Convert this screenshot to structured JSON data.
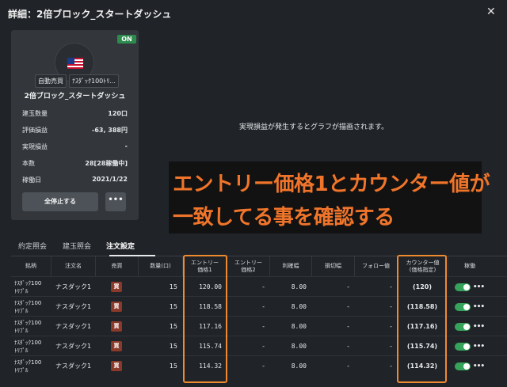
{
  "window": {
    "title": "詳細：2倍ブロック_スタートダッシュ",
    "close": "✕"
  },
  "card": {
    "status": "ON",
    "tags": [
      "自動売買",
      "ﾅｽﾀﾞｯｸ100ﾄﾘ..."
    ],
    "name": "2倍ブロック_スタートダッシュ",
    "stats": [
      {
        "label": "建玉数量",
        "value": "120口"
      },
      {
        "label": "評価損益",
        "value": "-63, 388円"
      },
      {
        "label": "実現損益",
        "value": "-"
      },
      {
        "label": "本数",
        "value": "28[28稼働中]"
      },
      {
        "label": "稼働日",
        "value": "2021/1/22"
      }
    ],
    "stop_all": "全停止する",
    "more": "•••"
  },
  "graph_message": "実現損益が発生するとグラフが描画されます。",
  "annotation": {
    "line1": "エントリー価格1とカウンター値が",
    "line2": "一致してる事を確認する"
  },
  "tabs": [
    {
      "label": "約定照会"
    },
    {
      "label": "建玉照会"
    },
    {
      "label": "注文設定"
    }
  ],
  "table": {
    "headers": {
      "symbol": "銘柄",
      "order_name": "注文名",
      "side": "売買",
      "qty": "数量(口)",
      "entry1_a": "エントリー",
      "entry1_b": "価格1",
      "entry2_a": "エントリー",
      "entry2_b": "価格2",
      "profit": "利確幅",
      "loss": "損切幅",
      "follow": "フォロー値",
      "counter_a": "カウンター値",
      "counter_b": "(価格指定)",
      "active": "稼働"
    },
    "rows": [
      {
        "sym1": "ﾅｽﾀﾞｯｸ100",
        "sym2": "ﾄﾘﾌﾟﾙ",
        "order": "ナスダック1",
        "side": "買",
        "qty": "15",
        "entry1": "120.00",
        "entry2": "-",
        "profit": "8.00",
        "loss": "-",
        "follow": "-",
        "counter": "(120)"
      },
      {
        "sym1": "ﾅｽﾀﾞｯｸ100",
        "sym2": "ﾄﾘﾌﾟﾙ",
        "order": "ナスダック1",
        "side": "買",
        "qty": "15",
        "entry1": "118.58",
        "entry2": "-",
        "profit": "8.00",
        "loss": "-",
        "follow": "-",
        "counter": "(118.58)"
      },
      {
        "sym1": "ﾅｽﾀﾞｯｸ100",
        "sym2": "ﾄﾘﾌﾟﾙ",
        "order": "ナスダック1",
        "side": "買",
        "qty": "15",
        "entry1": "117.16",
        "entry2": "-",
        "profit": "8.00",
        "loss": "-",
        "follow": "-",
        "counter": "(117.16)"
      },
      {
        "sym1": "ﾅｽﾀﾞｯｸ100",
        "sym2": "ﾄﾘﾌﾟﾙ",
        "order": "ナスダック1",
        "side": "買",
        "qty": "15",
        "entry1": "115.74",
        "entry2": "-",
        "profit": "8.00",
        "loss": "-",
        "follow": "-",
        "counter": "(115.74)"
      },
      {
        "sym1": "ﾅｽﾀﾞｯｸ100",
        "sym2": "ﾄﾘﾌﾟﾙ",
        "order": "ナスダック1",
        "side": "買",
        "qty": "15",
        "entry1": "114.32",
        "entry2": "-",
        "profit": "8.00",
        "loss": "-",
        "follow": "-",
        "counter": "(114.32)"
      }
    ]
  },
  "colors": {
    "accent": "#f0752a",
    "on": "#2e8b4e",
    "toggle": "#36a35a",
    "buy": "#8b3a2a"
  }
}
